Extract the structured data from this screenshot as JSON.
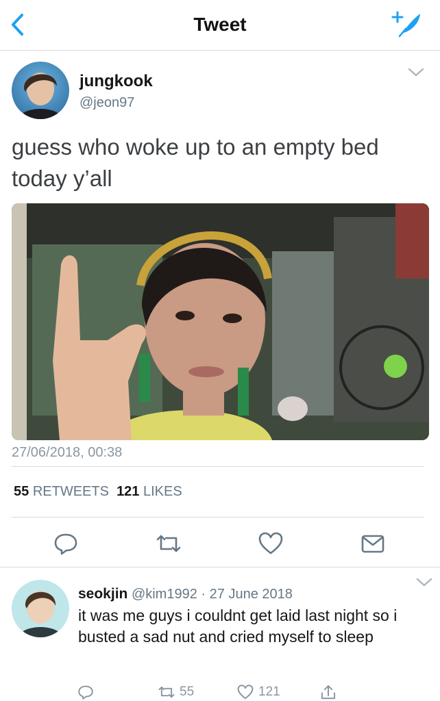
{
  "header": {
    "title": "Tweet",
    "back_icon": "chevron-left-icon",
    "compose_icon": "compose-tweet-icon",
    "accent": "#1da1f2"
  },
  "tweet": {
    "author_name": "jungkook",
    "author_handle": "@jeon97",
    "text": "guess who woke up to an empty bed today y’all",
    "timestamp": "27/06/2018, 00:38",
    "retweet_count": "55",
    "retweet_label": "RETWEETS",
    "like_count": "121",
    "like_label": "LIKES",
    "actions": [
      "reply-icon",
      "retweet-icon",
      "like-icon",
      "share-mail-icon"
    ]
  },
  "reply": {
    "author_name": "seokjin",
    "author_handle": "@kim1992",
    "separator": "·",
    "date": "27 June 2018",
    "text": "it was me guys i couldnt get laid last night so i busted a sad nut and cried myself to sleep",
    "retweet_count": "55",
    "like_count": "121"
  }
}
